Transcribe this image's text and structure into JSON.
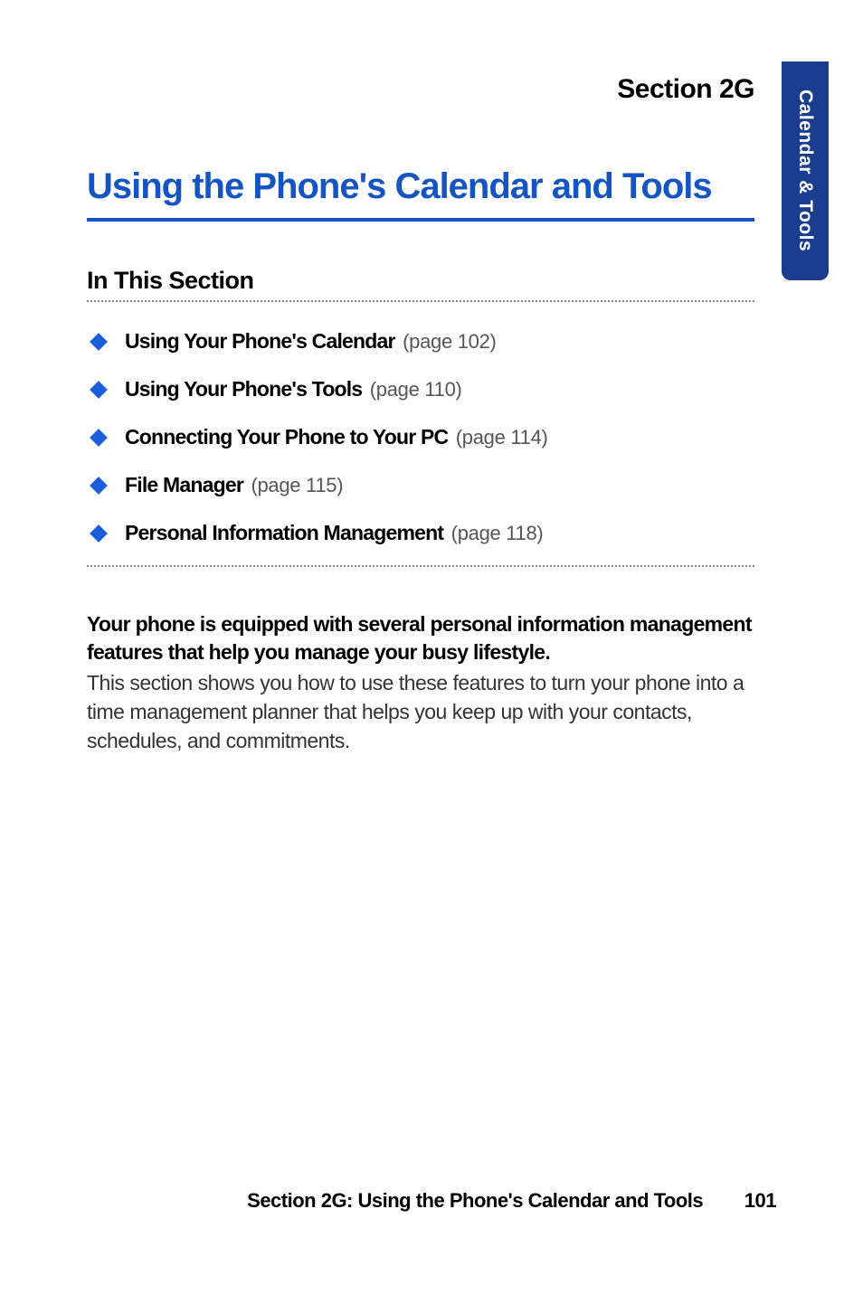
{
  "sideTab": {
    "label": "Calendar & Tools"
  },
  "sectionLabel": "Section 2G",
  "mainTitle": "Using the Phone's Calendar and Tools",
  "subsectionHeading": "In This Section",
  "toc": [
    {
      "title": "Using Your Phone's Calendar",
      "page": "(page 102)"
    },
    {
      "title": "Using Your Phone's Tools",
      "page": "(page 110)"
    },
    {
      "title": "Connecting Your Phone to Your PC",
      "page": "(page 114)"
    },
    {
      "title": "File Manager",
      "page": "(page 115)"
    },
    {
      "title": "Personal Information Management",
      "page": "(page 118)"
    }
  ],
  "intro": {
    "bold": "Your phone is equipped with several personal information management features that help you manage your busy lifestyle.",
    "regular": "This section shows you how to use these features to turn your phone into a time management planner that helps you keep up with your contacts, schedules, and commitments."
  },
  "footer": {
    "title": "Section 2G: Using the Phone's Calendar and Tools",
    "page": "101"
  }
}
